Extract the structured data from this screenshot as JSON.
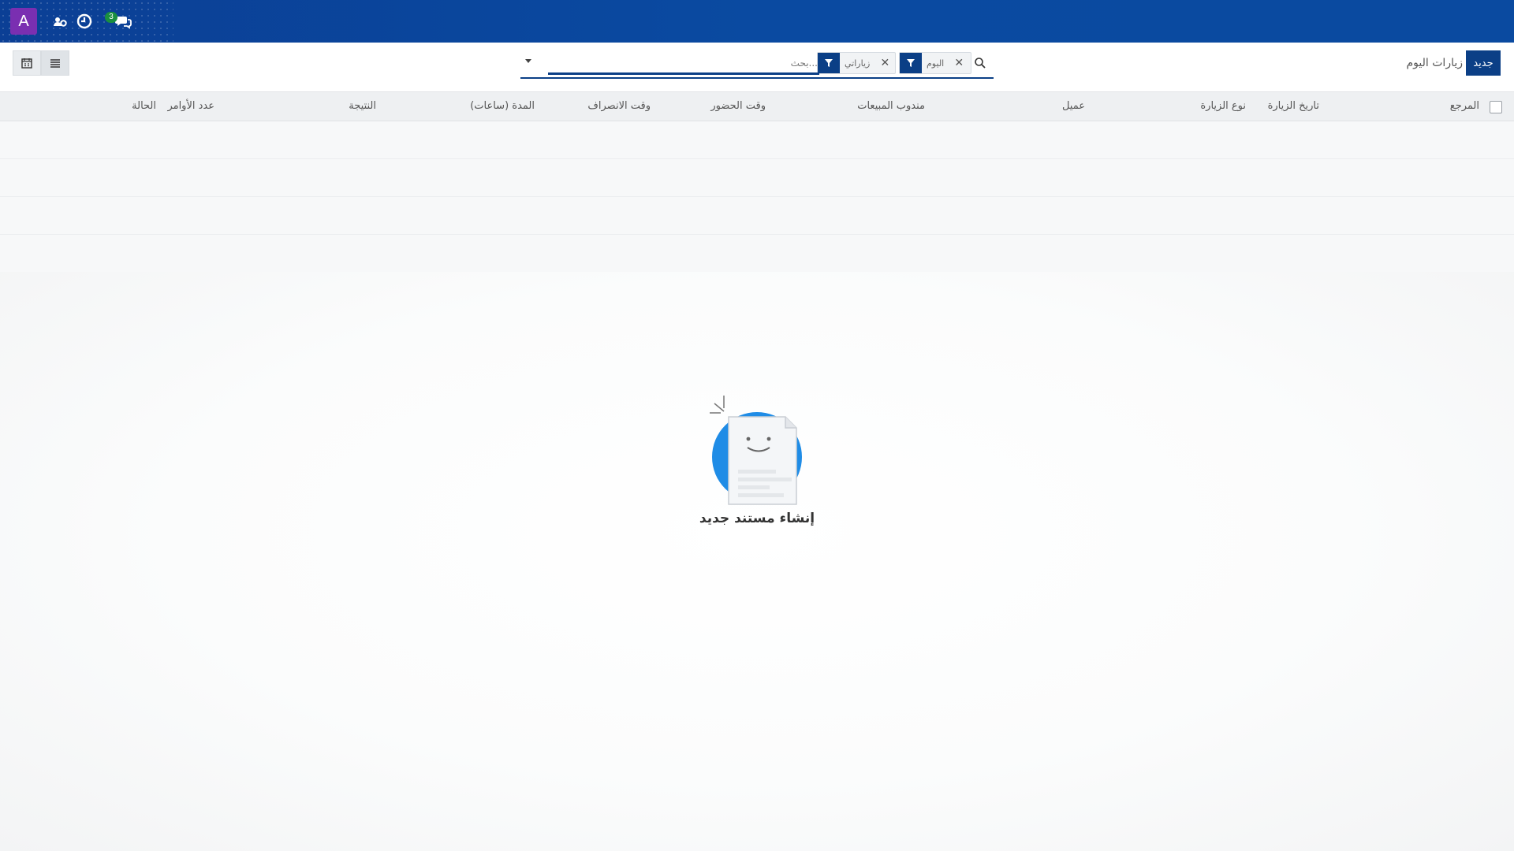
{
  "navbar": {
    "avatar_letter": "A",
    "messages_badge": "3",
    "icons": [
      "users-cog-icon",
      "clock-icon",
      "chat-icon"
    ]
  },
  "control": {
    "new_button": "جديد",
    "breadcrumb": "زيارات اليوم",
    "search": {
      "placeholder": "بحث...",
      "facets": [
        {
          "label": "اليوم"
        },
        {
          "label": "زياراتي"
        }
      ]
    }
  },
  "table": {
    "columns": {
      "ref": "المرجع",
      "visit_date": "تاريخ الزيارة",
      "visit_type": "نوع الزيارة",
      "customer": "عميل",
      "salesperson": "مندوب المبيعات",
      "check_in": "وقت الحضور",
      "check_out": "وقت الانصراف",
      "duration": "المدة (ساعات)",
      "result": "النتيجة",
      "orders_count": "عدد الأوامر",
      "status": "الحالة"
    }
  },
  "empty_state": {
    "title": "إنشاء مستند جديد"
  },
  "colors": {
    "navbar": "#0a4aa1",
    "primary": "#0b3f86",
    "avatar": "#7a2fb1",
    "badge": "#1a8f3f"
  }
}
